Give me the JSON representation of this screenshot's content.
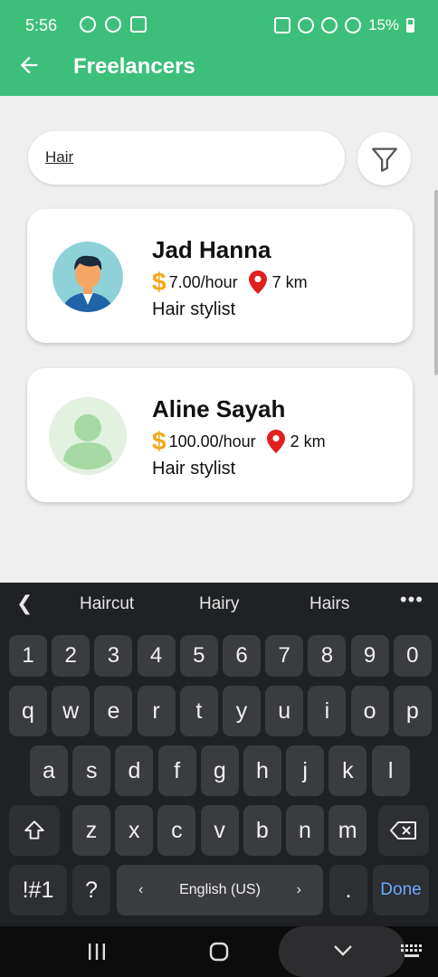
{
  "status_bar": {
    "time": "5:56",
    "battery": "15%"
  },
  "header": {
    "title": "Freelancers"
  },
  "search": {
    "value": "Hair"
  },
  "freelancers": [
    {
      "name": "Jad Hanna",
      "rate": "7.00/hour",
      "distance": "7 km",
      "role": "Hair stylist",
      "avatar": "male-avatar-icon"
    },
    {
      "name": "Aline Sayah",
      "rate": "100.00/hour",
      "distance": "2 km",
      "role": "Hair stylist",
      "avatar": "default-user-avatar-icon"
    }
  ],
  "keyboard": {
    "suggestions": [
      "Haircut",
      "Hairy",
      "Hairs"
    ],
    "number_row": [
      "1",
      "2",
      "3",
      "4",
      "5",
      "6",
      "7",
      "8",
      "9",
      "0"
    ],
    "row1": [
      "q",
      "w",
      "e",
      "r",
      "t",
      "y",
      "u",
      "i",
      "o",
      "p"
    ],
    "row2": [
      "a",
      "s",
      "d",
      "f",
      "g",
      "h",
      "j",
      "k",
      "l"
    ],
    "row3": [
      "z",
      "x",
      "c",
      "v",
      "b",
      "n",
      "m"
    ],
    "symbols_label": "!#1",
    "question": "?",
    "space_label": "English (US)",
    "period": ".",
    "done_label": "Done"
  },
  "colors": {
    "accent": "#3dbf7a",
    "dollar": "#f2a817",
    "pin": "#e01f1f"
  }
}
